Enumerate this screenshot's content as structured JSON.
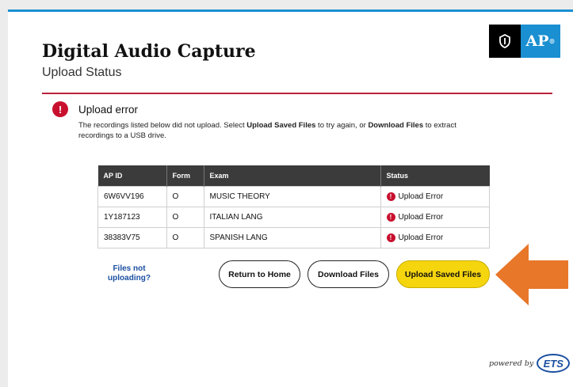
{
  "app": {
    "title": "Digital Audio Capture",
    "subtitle": "Upload Status",
    "logo_text": "AP"
  },
  "error": {
    "icon": "!",
    "heading": "Upload error",
    "msg_part1": "The recordings listed below did not upload. Select ",
    "msg_bold1": "Upload Saved Files",
    "msg_part2": " to try again, or ",
    "msg_bold2": "Download Files",
    "msg_part3": " to extract recordings to a USB drive."
  },
  "table": {
    "headers": [
      "AP ID",
      "Form",
      "Exam",
      "Status"
    ],
    "rows": [
      {
        "ap_id": "6W6VV196",
        "form": "O",
        "exam": "MUSIC THEORY",
        "status": "Upload Error"
      },
      {
        "ap_id": "1Y187123",
        "form": "O",
        "exam": "ITALIAN LANG",
        "status": "Upload Error"
      },
      {
        "ap_id": "38383V75",
        "form": "O",
        "exam": "SPANISH LANG",
        "status": "Upload Error"
      }
    ]
  },
  "actions": {
    "files_link_line1": "Files not",
    "files_link_line2": "uploading?",
    "return_home": "Return to Home",
    "download_files": "Download Files",
    "upload_saved_files": "Upload Saved Files"
  },
  "footer": {
    "powered_by": "powered by",
    "ets": "ETS"
  },
  "colors": {
    "accent_blue": "#1a8fd1",
    "divider_red": "#b8233d",
    "error_red": "#c8102e",
    "upload_yellow": "#f5d50e",
    "arrow_orange": "#e8772a"
  },
  "icons": {
    "logo_mark": "shield-icon",
    "error": "exclamation-circle-icon",
    "callout": "arrow-left-icon"
  }
}
